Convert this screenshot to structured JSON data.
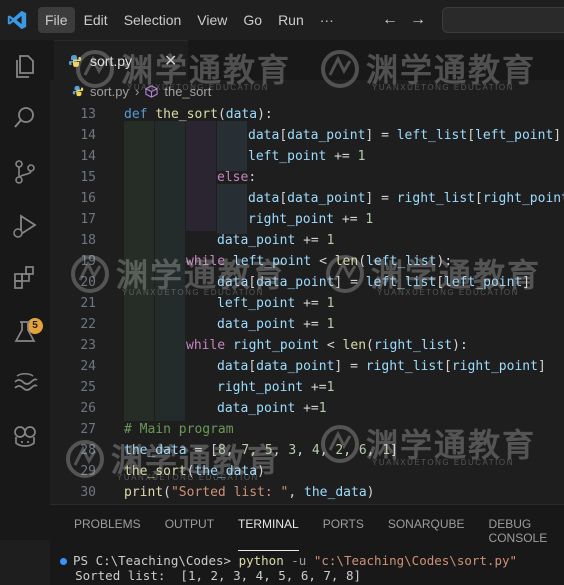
{
  "menu": [
    "File",
    "Edit",
    "Selection",
    "View",
    "Go",
    "Run",
    "···"
  ],
  "tab": {
    "label": "sort.py"
  },
  "breadcrumb": {
    "file": "sort.py",
    "symbol": "the_sort"
  },
  "activity": {
    "extensions_badge": "5"
  },
  "editor": {
    "lines": [
      {
        "n": "13",
        "indent": 0,
        "tokens": [
          [
            "kwb",
            "def "
          ],
          [
            "fn",
            "the_sort"
          ],
          [
            "pl",
            "("
          ],
          [
            "var",
            "data"
          ],
          [
            "pl",
            "):"
          ]
        ]
      },
      {
        "n": "14",
        "indent": 16,
        "tokens": [
          [
            "var",
            "data"
          ],
          [
            "pl",
            "["
          ],
          [
            "var",
            "data_point"
          ],
          [
            "pl",
            "] = "
          ],
          [
            "var",
            "left_list"
          ],
          [
            "pl",
            "["
          ],
          [
            "var",
            "left_point"
          ],
          [
            "pl",
            "]"
          ]
        ]
      },
      {
        "n": "14",
        "indent": 16,
        "tokens": [
          [
            "var",
            "left_point"
          ],
          [
            "pl",
            " += "
          ],
          [
            "num",
            "1"
          ]
        ]
      },
      {
        "n": "15",
        "indent": 12,
        "tokens": [
          [
            "kw",
            "else"
          ],
          [
            "pl",
            ":"
          ]
        ]
      },
      {
        "n": "16",
        "indent": 16,
        "tokens": [
          [
            "var",
            "data"
          ],
          [
            "pl",
            "["
          ],
          [
            "var",
            "data_point"
          ],
          [
            "pl",
            "] = "
          ],
          [
            "var",
            "right_list"
          ],
          [
            "pl",
            "["
          ],
          [
            "var",
            "right_point"
          ],
          [
            "pl",
            "]"
          ]
        ]
      },
      {
        "n": "17",
        "indent": 16,
        "tokens": [
          [
            "var",
            "right_point"
          ],
          [
            "pl",
            " += "
          ],
          [
            "num",
            "1"
          ]
        ]
      },
      {
        "n": "18",
        "indent": 12,
        "tokens": [
          [
            "var",
            "data_point"
          ],
          [
            "pl",
            " += "
          ],
          [
            "num",
            "1"
          ]
        ]
      },
      {
        "n": "19",
        "indent": 8,
        "tokens": [
          [
            "kw",
            "while "
          ],
          [
            "var",
            "left_point"
          ],
          [
            "pl",
            " < "
          ],
          [
            "bi",
            "len"
          ],
          [
            "pl",
            "("
          ],
          [
            "var",
            "left_list"
          ],
          [
            "pl",
            "):"
          ]
        ]
      },
      {
        "n": "20",
        "indent": 12,
        "tokens": [
          [
            "var",
            "data"
          ],
          [
            "pl",
            "["
          ],
          [
            "var",
            "data_point"
          ],
          [
            "pl",
            "] = "
          ],
          [
            "var",
            "left_list"
          ],
          [
            "pl",
            "["
          ],
          [
            "var",
            "left_point"
          ],
          [
            "pl",
            "]"
          ]
        ]
      },
      {
        "n": "21",
        "indent": 12,
        "tokens": [
          [
            "var",
            "left_point"
          ],
          [
            "pl",
            " += "
          ],
          [
            "num",
            "1"
          ]
        ]
      },
      {
        "n": "22",
        "indent": 12,
        "tokens": [
          [
            "var",
            "data_point"
          ],
          [
            "pl",
            " += "
          ],
          [
            "num",
            "1"
          ]
        ]
      },
      {
        "n": "23",
        "indent": 8,
        "tokens": [
          [
            "kw",
            "while "
          ],
          [
            "var",
            "right_point"
          ],
          [
            "pl",
            " < "
          ],
          [
            "bi",
            "len"
          ],
          [
            "pl",
            "("
          ],
          [
            "var",
            "right_list"
          ],
          [
            "pl",
            "):"
          ]
        ]
      },
      {
        "n": "24",
        "indent": 12,
        "tokens": [
          [
            "var",
            "data"
          ],
          [
            "pl",
            "["
          ],
          [
            "var",
            "data_point"
          ],
          [
            "pl",
            "] = "
          ],
          [
            "var",
            "right_list"
          ],
          [
            "pl",
            "["
          ],
          [
            "var",
            "right_point"
          ],
          [
            "pl",
            "]"
          ]
        ]
      },
      {
        "n": "25",
        "indent": 12,
        "tokens": [
          [
            "var",
            "right_point"
          ],
          [
            "pl",
            " +="
          ],
          [
            "num",
            "1"
          ]
        ]
      },
      {
        "n": "26",
        "indent": 12,
        "tokens": [
          [
            "var",
            "data_point"
          ],
          [
            "pl",
            " +="
          ],
          [
            "num",
            "1"
          ]
        ]
      },
      {
        "n": "27",
        "indent": 0,
        "tokens": [
          [
            "cmt",
            "# Main program"
          ]
        ]
      },
      {
        "n": "28",
        "indent": 0,
        "tokens": [
          [
            "var",
            "the_data"
          ],
          [
            "pl",
            " = ["
          ],
          [
            "num",
            "8"
          ],
          [
            "pl",
            ", "
          ],
          [
            "num",
            "7"
          ],
          [
            "pl",
            ", "
          ],
          [
            "num",
            "5"
          ],
          [
            "pl",
            ", "
          ],
          [
            "num",
            "3"
          ],
          [
            "pl",
            ", "
          ],
          [
            "num",
            "4"
          ],
          [
            "pl",
            ", "
          ],
          [
            "num",
            "2"
          ],
          [
            "pl",
            ", "
          ],
          [
            "num",
            "6"
          ],
          [
            "pl",
            ", "
          ],
          [
            "num",
            "1"
          ],
          [
            "pl",
            "]"
          ]
        ]
      },
      {
        "n": "29",
        "indent": 0,
        "tokens": [
          [
            "fn",
            "the_sort"
          ],
          [
            "pl",
            "("
          ],
          [
            "var",
            "the_data"
          ],
          [
            "pl",
            ")"
          ]
        ]
      },
      {
        "n": "30",
        "indent": 0,
        "tokens": [
          [
            "bi",
            "print"
          ],
          [
            "pl",
            "("
          ],
          [
            "str",
            "\"Sorted list: \""
          ],
          [
            "pl",
            ", "
          ],
          [
            "var",
            "the_data"
          ],
          [
            "pl",
            ")"
          ]
        ]
      }
    ]
  },
  "panel": {
    "tabs": [
      "PROBLEMS",
      "OUTPUT",
      "TERMINAL",
      "PORTS",
      "SONARQUBE",
      "DEBUG CONSOLE"
    ],
    "active_tab": "TERMINAL",
    "terminal": {
      "prompt": "PS C:\\Teaching\\Codes> ",
      "command": "python",
      "flag": " -u ",
      "arg": "\"c:\\Teaching\\Codes\\sort.py\"",
      "output": "Sorted list:  [1, 2, 3, 4, 5, 6, 7, 8]"
    }
  },
  "watermark": {
    "text": "渊学通教育",
    "sub": "YUANXUETONG EDUCATION"
  }
}
